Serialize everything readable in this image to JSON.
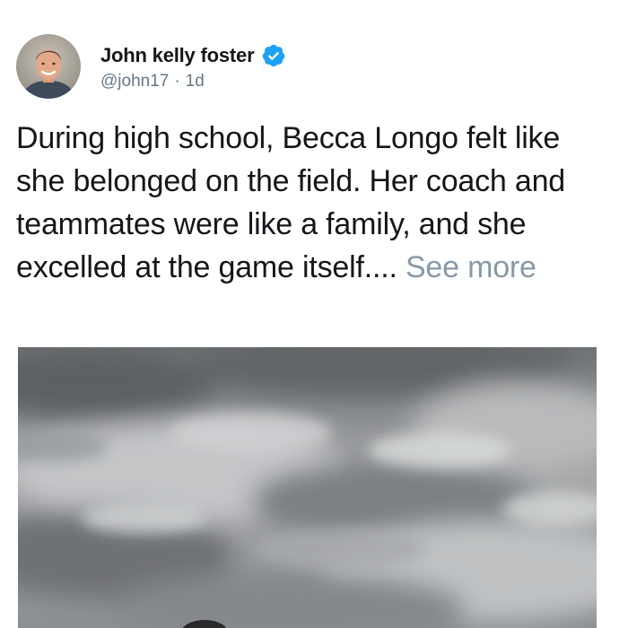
{
  "post": {
    "author": {
      "display_name": "John kelly foster",
      "handle": "@john17",
      "separator": "·",
      "time": "1d",
      "verified": true,
      "avatar_icon": "avatar-photo-icon"
    },
    "text": "During high school, Becca Longo felt like she belonged on the field. Her coach and teammates were like a family, and she excelled at the game itself....",
    "see_more_label": "See more",
    "media": {
      "kind": "photo",
      "icon": "cloudy-sky-photo"
    }
  },
  "colors": {
    "text_primary": "#14171a",
    "text_secondary": "#657786",
    "see_more": "#8899a6",
    "verified_badge": "#1da1f2"
  }
}
